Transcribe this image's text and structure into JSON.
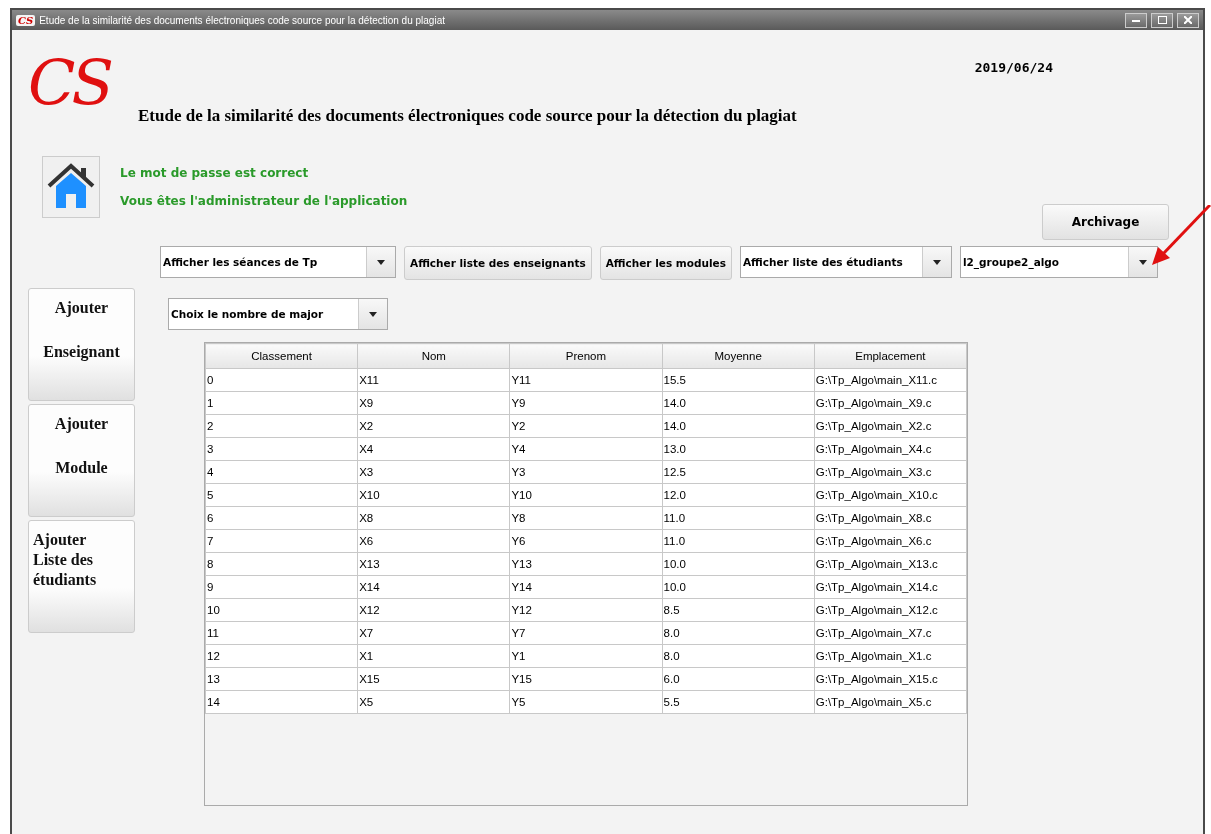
{
  "window": {
    "title": "Etude de la similarité des documents électroniques code source pour la détection du plagiat",
    "title_logo": "CS"
  },
  "header": {
    "logo": "CS",
    "title": "Etude de la similarité des documents électroniques code source pour la détection du plagiat",
    "date": "2019/06/24"
  },
  "messages": [
    "Le mot de passe est correct",
    "Vous êtes l'administrateur de l'application"
  ],
  "archive_button": "Archivage",
  "toolbar": [
    {
      "kind": "combo",
      "value": "Afficher les séances de Tp"
    },
    {
      "kind": "button",
      "label": "Afficher liste des enseignants"
    },
    {
      "kind": "button",
      "label": "Afficher les modules"
    },
    {
      "kind": "combo",
      "value": "Afficher liste des étudiants"
    },
    {
      "kind": "combo",
      "value": "l2_groupe2_algo"
    }
  ],
  "sidebar": [
    {
      "kind": "spaced",
      "lines": [
        "Ajouter",
        "Enseignant"
      ]
    },
    {
      "kind": "spaced",
      "lines": [
        "Ajouter",
        "Module"
      ]
    },
    {
      "kind": "stacked",
      "lines": [
        "Ajouter",
        "Liste des",
        "étudiants"
      ]
    }
  ],
  "major_combo": "Choix le nombre de major",
  "table": {
    "columns": [
      "Classement",
      "Nom",
      "Prenom",
      "Moyenne",
      "Emplacement"
    ],
    "rows": [
      [
        "0",
        "X11",
        "Y11",
        "15.5",
        "G:\\Tp_Algo\\main_X11.c"
      ],
      [
        "1",
        "X9",
        "Y9",
        "14.0",
        "G:\\Tp_Algo\\main_X9.c"
      ],
      [
        "2",
        "X2",
        "Y2",
        "14.0",
        "G:\\Tp_Algo\\main_X2.c"
      ],
      [
        "3",
        "X4",
        "Y4",
        "13.0",
        "G:\\Tp_Algo\\main_X4.c"
      ],
      [
        "4",
        "X3",
        "Y3",
        "12.5",
        "G:\\Tp_Algo\\main_X3.c"
      ],
      [
        "5",
        "X10",
        "Y10",
        "12.0",
        "G:\\Tp_Algo\\main_X10.c"
      ],
      [
        "6",
        "X8",
        "Y8",
        "11.0",
        "G:\\Tp_Algo\\main_X8.c"
      ],
      [
        "7",
        "X6",
        "Y6",
        "11.0",
        "G:\\Tp_Algo\\main_X6.c"
      ],
      [
        "8",
        "X13",
        "Y13",
        "10.0",
        "G:\\Tp_Algo\\main_X13.c"
      ],
      [
        "9",
        "X14",
        "Y14",
        "10.0",
        "G:\\Tp_Algo\\main_X14.c"
      ],
      [
        "10",
        "X12",
        "Y12",
        "8.5",
        "G:\\Tp_Algo\\main_X12.c"
      ],
      [
        "11",
        "X7",
        "Y7",
        "8.0",
        "G:\\Tp_Algo\\main_X7.c"
      ],
      [
        "12",
        "X1",
        "Y1",
        "8.0",
        "G:\\Tp_Algo\\main_X1.c"
      ],
      [
        "13",
        "X15",
        "Y15",
        "6.0",
        "G:\\Tp_Algo\\main_X15.c"
      ],
      [
        "14",
        "X5",
        "Y5",
        "5.5",
        "G:\\Tp_Algo\\main_X5.c"
      ]
    ]
  }
}
